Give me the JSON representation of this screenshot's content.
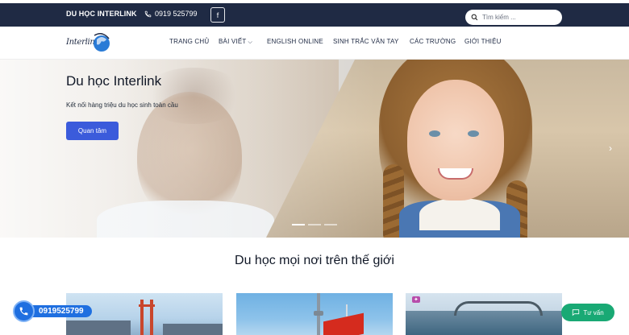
{
  "topbar": {
    "brand": "DU HỌC INTERLINK",
    "phone": "0919 525799",
    "facebook_icon": "facebook-icon",
    "search_placeholder": "Tìm kiếm ..."
  },
  "logo": {
    "text": "Interlink"
  },
  "nav": {
    "items": [
      {
        "label": "TRANG CHỦ"
      },
      {
        "label": "BÀI VIẾT",
        "has_dropdown": true
      },
      {
        "label": "ENGLISH ONLINE"
      },
      {
        "label": "SINH TRẮC VÂN TAY"
      },
      {
        "label": "CÁC TRƯỜNG"
      },
      {
        "label": "GIỚI THIỆU"
      }
    ]
  },
  "hero": {
    "title": "Du học Interlink",
    "subtitle": "Kết nối hàng triệu du học sinh toàn cầu",
    "button": "Quan tâm",
    "next_icon": "chevron-right-icon",
    "slide_count": 3,
    "active_slide": 1
  },
  "section": {
    "title": "Du học mọi nơi trên thế giới"
  },
  "cards": [
    {
      "image": "san-francisco-bridge"
    },
    {
      "image": "toronto-canada-flag"
    },
    {
      "image": "sydney-harbour"
    }
  ],
  "floating": {
    "phone": "0919525799",
    "consult": "Tư vấn"
  },
  "colors": {
    "topbar": "#1f2a44",
    "accent": "#3b5bdb",
    "phone_float": "#1f6fe0",
    "consult": "#19a974"
  }
}
